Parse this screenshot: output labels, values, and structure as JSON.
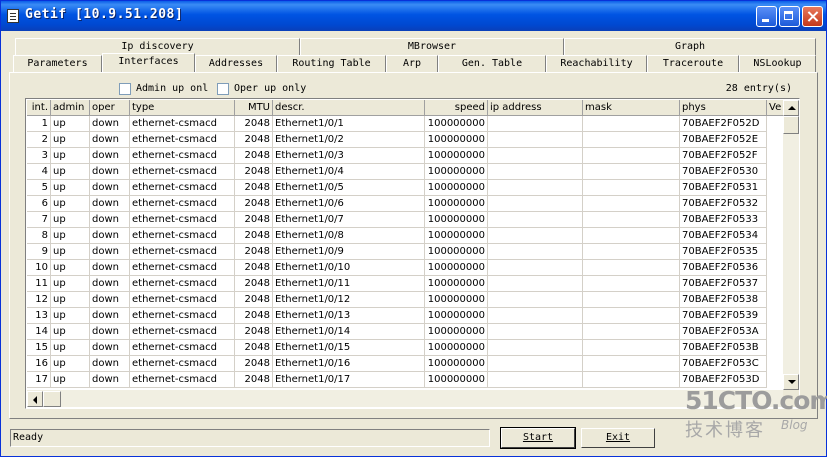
{
  "window": {
    "title": "Getif [10.9.51.208]"
  },
  "tabs_row1": [
    "Ip discovery",
    "MBrowser",
    "Graph"
  ],
  "tabs_row2": [
    "Parameters",
    "Interfaces",
    "Addresses",
    "Routing Table",
    "Arp",
    "Gen. Table",
    "Reachability",
    "Traceroute",
    "NSLookup"
  ],
  "active_tab": "Interfaces",
  "filters": {
    "admin_up": "Admin up onl",
    "oper_up": "Oper up only"
  },
  "entry_count": "28 entry(s)",
  "table": {
    "columns": [
      "int.",
      "admin",
      "oper",
      "type",
      "MTU",
      "descr.",
      "speed",
      "ip address",
      "mask",
      "phys",
      "Ve"
    ],
    "rows": [
      [
        "1",
        "up",
        "down",
        "ethernet-csmacd",
        "2048",
        "Ethernet1/0/1",
        "100000000",
        "",
        "",
        "70BAEF2F052D"
      ],
      [
        "2",
        "up",
        "down",
        "ethernet-csmacd",
        "2048",
        "Ethernet1/0/2",
        "100000000",
        "",
        "",
        "70BAEF2F052E"
      ],
      [
        "3",
        "up",
        "down",
        "ethernet-csmacd",
        "2048",
        "Ethernet1/0/3",
        "100000000",
        "",
        "",
        "70BAEF2F052F"
      ],
      [
        "4",
        "up",
        "down",
        "ethernet-csmacd",
        "2048",
        "Ethernet1/0/4",
        "100000000",
        "",
        "",
        "70BAEF2F0530"
      ],
      [
        "5",
        "up",
        "down",
        "ethernet-csmacd",
        "2048",
        "Ethernet1/0/5",
        "100000000",
        "",
        "",
        "70BAEF2F0531"
      ],
      [
        "6",
        "up",
        "down",
        "ethernet-csmacd",
        "2048",
        "Ethernet1/0/6",
        "100000000",
        "",
        "",
        "70BAEF2F0532"
      ],
      [
        "7",
        "up",
        "down",
        "ethernet-csmacd",
        "2048",
        "Ethernet1/0/7",
        "100000000",
        "",
        "",
        "70BAEF2F0533"
      ],
      [
        "8",
        "up",
        "down",
        "ethernet-csmacd",
        "2048",
        "Ethernet1/0/8",
        "100000000",
        "",
        "",
        "70BAEF2F0534"
      ],
      [
        "9",
        "up",
        "down",
        "ethernet-csmacd",
        "2048",
        "Ethernet1/0/9",
        "100000000",
        "",
        "",
        "70BAEF2F0535"
      ],
      [
        "10",
        "up",
        "down",
        "ethernet-csmacd",
        "2048",
        "Ethernet1/0/10",
        "100000000",
        "",
        "",
        "70BAEF2F0536"
      ],
      [
        "11",
        "up",
        "down",
        "ethernet-csmacd",
        "2048",
        "Ethernet1/0/11",
        "100000000",
        "",
        "",
        "70BAEF2F0537"
      ],
      [
        "12",
        "up",
        "down",
        "ethernet-csmacd",
        "2048",
        "Ethernet1/0/12",
        "100000000",
        "",
        "",
        "70BAEF2F0538"
      ],
      [
        "13",
        "up",
        "down",
        "ethernet-csmacd",
        "2048",
        "Ethernet1/0/13",
        "100000000",
        "",
        "",
        "70BAEF2F0539"
      ],
      [
        "14",
        "up",
        "down",
        "ethernet-csmacd",
        "2048",
        "Ethernet1/0/14",
        "100000000",
        "",
        "",
        "70BAEF2F053A"
      ],
      [
        "15",
        "up",
        "down",
        "ethernet-csmacd",
        "2048",
        "Ethernet1/0/15",
        "100000000",
        "",
        "",
        "70BAEF2F053B"
      ],
      [
        "16",
        "up",
        "down",
        "ethernet-csmacd",
        "2048",
        "Ethernet1/0/16",
        "100000000",
        "",
        "",
        "70BAEF2F053C"
      ],
      [
        "17",
        "up",
        "down",
        "ethernet-csmacd",
        "2048",
        "Ethernet1/0/17",
        "100000000",
        "",
        "",
        "70BAEF2F053D"
      ]
    ]
  },
  "status": "Ready",
  "buttons": {
    "start": "Start",
    "exit": "Exit"
  },
  "watermark": {
    "line1": "51CTO.com",
    "line2": "技术博客",
    "blog": "Blog"
  }
}
